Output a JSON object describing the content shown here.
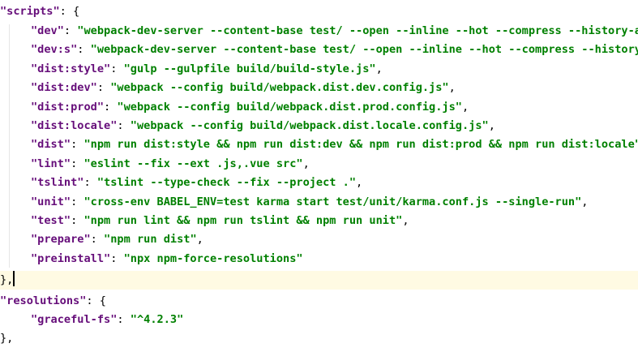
{
  "colors": {
    "key": "#660e7a",
    "string": "#008000",
    "punctuation": "#000000",
    "current_line": "#fffae3",
    "indent_guide": "#e6e6e6"
  },
  "code": {
    "scripts_open": {
      "key": "\"scripts\"",
      "sep": ": {"
    },
    "entries": [
      {
        "key": "\"dev\"",
        "sep": ": ",
        "value": "\"webpack-dev-server --content-base test/ --open --inline --hot --compress --history-ap",
        "tail": ""
      },
      {
        "key": "\"dev:s\"",
        "sep": ": ",
        "value": "\"webpack-dev-server --content-base test/ --open --inline --hot --compress --history-",
        "tail": ""
      },
      {
        "key": "\"dist:style\"",
        "sep": ": ",
        "value": "\"gulp --gulpfile build/build-style.js\"",
        "tail": ","
      },
      {
        "key": "\"dist:dev\"",
        "sep": ": ",
        "value": "\"webpack --config build/webpack.dist.dev.config.js\"",
        "tail": ","
      },
      {
        "key": "\"dist:prod\"",
        "sep": ": ",
        "value": "\"webpack --config build/webpack.dist.prod.config.js\"",
        "tail": ","
      },
      {
        "key": "\"dist:locale\"",
        "sep": ": ",
        "value": "\"webpack --config build/webpack.dist.locale.config.js\"",
        "tail": ","
      },
      {
        "key": "\"dist\"",
        "sep": ": ",
        "value": "\"npm run dist:style && npm run dist:dev && npm run dist:prod && npm run dist:locale\"",
        "tail": ","
      },
      {
        "key": "\"lint\"",
        "sep": ": ",
        "value": "\"eslint --fix --ext .js,.vue src\"",
        "tail": ","
      },
      {
        "key": "\"tslint\"",
        "sep": ": ",
        "value": "\"tslint --type-check --fix --project .\"",
        "tail": ","
      },
      {
        "key": "\"unit\"",
        "sep": ": ",
        "value": "\"cross-env BABEL_ENV=test karma start test/unit/karma.conf.js --single-run\"",
        "tail": ","
      },
      {
        "key": "\"test\"",
        "sep": ": ",
        "value": "\"npm run lint && npm run tslint && npm run unit\"",
        "tail": ","
      },
      {
        "key": "\"prepare\"",
        "sep": ": ",
        "value": "\"npm run dist\"",
        "tail": ","
      },
      {
        "key": "\"preinstall\"",
        "sep": ": ",
        "value": "\"npx npm-force-resolutions\"",
        "tail": ""
      }
    ],
    "scripts_close": "},",
    "resolutions_open": {
      "key": "\"resolutions\"",
      "sep": ": {"
    },
    "resolution_entry": {
      "key": "\"graceful-fs\"",
      "sep": ": ",
      "value": "\"^4.2.3\""
    },
    "resolutions_close": "},"
  }
}
